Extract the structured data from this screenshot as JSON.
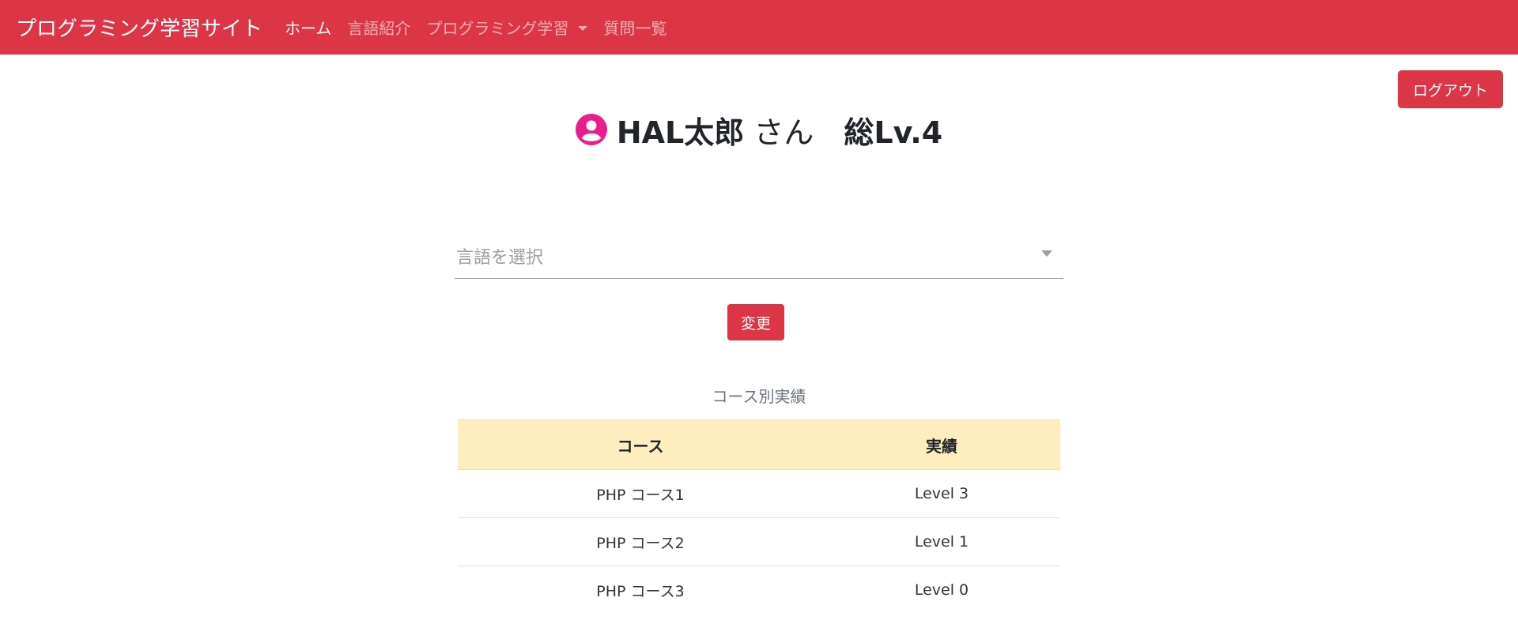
{
  "navbar": {
    "brand": "プログラミング学習サイト",
    "items": [
      {
        "label": "ホーム",
        "active": true
      },
      {
        "label": "言語紹介",
        "active": false
      },
      {
        "label": "プログラミング学習",
        "active": false,
        "dropdown": true
      },
      {
        "label": "質問一覧",
        "active": false
      }
    ],
    "color": "#dc3545"
  },
  "header": {
    "logout_label": "ログアウト"
  },
  "profile": {
    "icon": "user-circle-icon",
    "icon_color": "#e91e8c",
    "name": "HAL太郎",
    "suffix": " さん",
    "level_label": "総Lv.4"
  },
  "language_select": {
    "placeholder": "言語を選択"
  },
  "change_button": {
    "label": "変更"
  },
  "results": {
    "caption": "コース別実績",
    "headers": [
      "コース",
      "実績"
    ],
    "rows": [
      {
        "course": "PHP コース1",
        "result": "Level 3"
      },
      {
        "course": "PHP コース2",
        "result": "Level 1"
      },
      {
        "course": "PHP コース3",
        "result": "Level 0"
      }
    ],
    "header_color": "#feeebf"
  }
}
